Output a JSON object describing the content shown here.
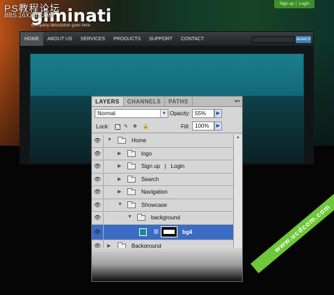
{
  "watermark": {
    "title": "PS教程论坛",
    "sub": "BBS.16XX8.COM"
  },
  "site": {
    "logo": "giminati",
    "tagline": "Company description goes here",
    "signup": "Sign up",
    "separator": "|",
    "login": "Login",
    "nav": [
      "HOME",
      "ABOUT US",
      "SERVICES",
      "PRODUCTS",
      "SUPPORT",
      "CONTACT"
    ],
    "search_button": "SEARCH"
  },
  "panel": {
    "tabs": [
      "LAYERS",
      "CHANNELS",
      "PATHS"
    ],
    "menu_glyph": "▾≡",
    "blend_mode": "Normal",
    "opacity_label": "Opacity:",
    "opacity_value": "55%",
    "lock_label": "Lock:",
    "fill_label": "Fill:",
    "fill_value": "100%",
    "layers": [
      {
        "name": "Home",
        "type": "group",
        "expanded": true,
        "depth": 0
      },
      {
        "name": "logo",
        "type": "group",
        "expanded": false,
        "depth": 1
      },
      {
        "name": "Sign up   |   Login",
        "type": "group",
        "expanded": false,
        "depth": 1
      },
      {
        "name": "Search",
        "type": "group",
        "expanded": false,
        "depth": 1
      },
      {
        "name": "Navigation",
        "type": "group",
        "expanded": false,
        "depth": 1
      },
      {
        "name": "Showcase",
        "type": "group",
        "expanded": true,
        "depth": 1
      },
      {
        "name": "background",
        "type": "group",
        "expanded": true,
        "depth": 2
      },
      {
        "name": "bg4",
        "type": "layer",
        "selected": true,
        "depth": 3
      },
      {
        "name": "Background",
        "type": "group",
        "expanded": false,
        "depth": 0
      }
    ]
  },
  "ribbon": "www.ucdcom.com",
  "colors": {
    "selected_row": "#3a6cc4",
    "banner": "#1c7f8c",
    "ribbon": "#6fc73a"
  }
}
